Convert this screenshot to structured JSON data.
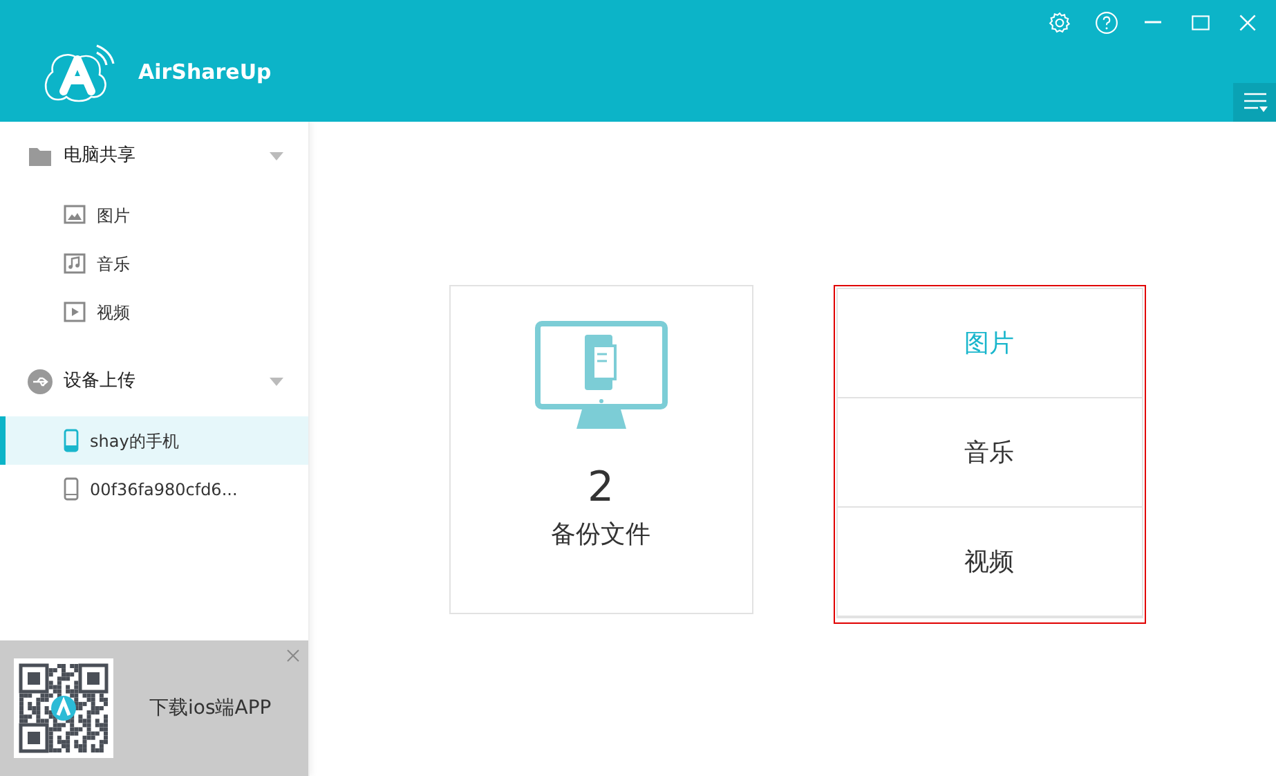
{
  "app": {
    "title": "AirShareUp"
  },
  "window_controls": [
    {
      "kind": "settings"
    },
    {
      "kind": "help"
    },
    {
      "kind": "minimize"
    },
    {
      "kind": "maximize"
    },
    {
      "kind": "close"
    }
  ],
  "sidebar": {
    "groups": [
      {
        "label": "电脑共享",
        "kind": "folder",
        "expanded": true,
        "items": [
          {
            "label": "图片",
            "kind": "image",
            "selected": false
          },
          {
            "label": "音乐",
            "kind": "music",
            "selected": false
          },
          {
            "label": "视频",
            "kind": "video",
            "selected": false
          }
        ]
      },
      {
        "label": "设备上传",
        "kind": "usb",
        "expanded": true,
        "items": [
          {
            "label": "shay的手机",
            "kind": "phone",
            "selected": true
          },
          {
            "label": "00f36fa980cfd6...",
            "kind": "phone",
            "selected": false
          }
        ]
      }
    ]
  },
  "promo": {
    "text": "下载ios端APP"
  },
  "backup_card": {
    "count": "2",
    "label": "备份文件"
  },
  "categories": {
    "outlined": true,
    "items": [
      {
        "label": "图片",
        "selected": true
      },
      {
        "label": "音乐",
        "selected": false
      },
      {
        "label": "视频",
        "selected": false
      }
    ]
  }
}
